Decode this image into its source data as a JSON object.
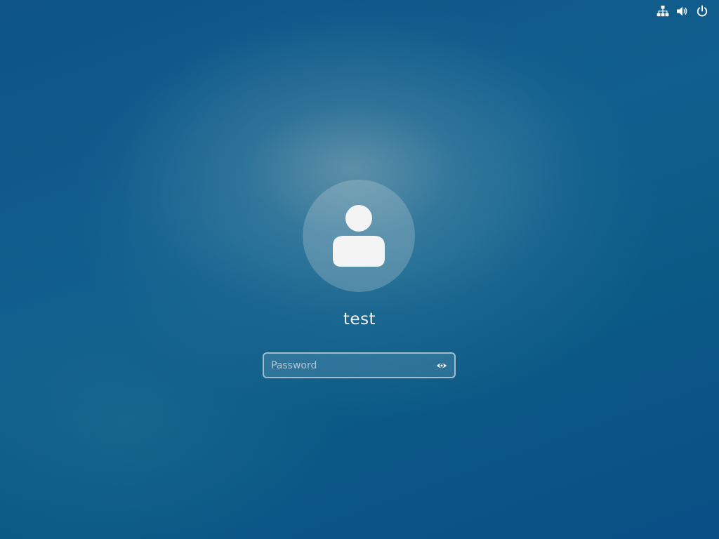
{
  "system_tray": {
    "icons": [
      "network-icon",
      "volume-icon",
      "power-icon"
    ]
  },
  "login": {
    "username": "test",
    "password_placeholder": "Password",
    "password_value": ""
  },
  "colors": {
    "background_primary": "#0e5487",
    "text": "#f2f4f5",
    "icon": "#ffffff"
  }
}
